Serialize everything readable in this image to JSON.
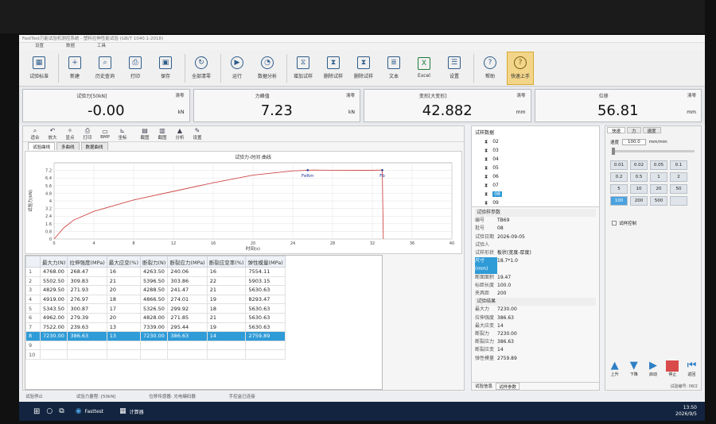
{
  "window": {
    "title": "FastTest万能试验机测控系统 - 塑料拉伸性能试验 (GB/T 1040.1-2018)"
  },
  "menu": [
    "设置",
    "数据",
    "工具"
  ],
  "toolbar": [
    {
      "icon": "grid-icon",
      "label": "试验标准"
    },
    {
      "icon": "new-icon",
      "label": "新建"
    },
    {
      "icon": "history-icon",
      "label": "历史查询"
    },
    {
      "icon": "print-icon",
      "label": "打印"
    },
    {
      "icon": "save-icon",
      "label": "保存"
    },
    {
      "icon": "refresh-icon",
      "label": "全部清零"
    },
    {
      "icon": "play-icon",
      "label": "运行"
    },
    {
      "icon": "analysis-icon",
      "label": "数据分析"
    },
    {
      "icon": "add-specimen-icon",
      "label": "增加试样"
    },
    {
      "icon": "delete-specimen-icon",
      "label": "删除试样"
    },
    {
      "icon": "delete-specimen-icon-2",
      "label": "删除试样"
    },
    {
      "icon": "text-icon",
      "label": "文本"
    },
    {
      "icon": "excel-icon",
      "label": "Excel"
    },
    {
      "icon": "settings-icon",
      "label": "设置"
    },
    {
      "icon": "help-icon",
      "label": "帮助"
    },
    {
      "icon": "help-icon-2",
      "label": "快速上手"
    }
  ],
  "readouts": [
    {
      "label": "试验力[50kN]",
      "value": "-0.00",
      "unit": "kN",
      "clear": "清零"
    },
    {
      "label": "力峰值",
      "value": "7.23",
      "unit": "kN",
      "clear": "清零"
    },
    {
      "label": "变形[大变形]",
      "value": "42.882",
      "unit": "mm",
      "clear": "清零"
    },
    {
      "label": "位移",
      "value": "56.81",
      "unit": "mm",
      "clear": "清零"
    }
  ],
  "graph_tools": [
    "适合",
    "放大",
    "显点",
    "打印",
    "BMP",
    "坐标",
    "截图",
    "截图",
    "分析",
    "设置"
  ],
  "curve_tabs": [
    "试验曲线",
    "多曲线",
    "数据曲线"
  ],
  "chart_data": {
    "type": "line",
    "title": "试验力-时间 曲线",
    "xlabel": "时间(s)",
    "ylabel": "试验力(kN)",
    "xlim": [
      0,
      40
    ],
    "ylim": [
      0,
      8
    ],
    "xticks": [
      "0",
      "4",
      "8",
      "12",
      "16",
      "20",
      "24",
      "28",
      "32",
      "36",
      "40"
    ],
    "yticks": [
      "0",
      "0.8",
      "1.6",
      "2.4",
      "3.2",
      "4",
      "4.8",
      "5.6",
      "6.4",
      "7.2"
    ],
    "x": [
      0,
      1,
      2,
      4,
      8,
      12,
      16,
      20,
      24,
      26,
      28,
      32,
      33,
      33.1
    ],
    "y": [
      0,
      1.2,
      2.0,
      2.9,
      4.1,
      5.0,
      5.9,
      6.7,
      7.15,
      7.23,
      7.22,
      7.21,
      7.23,
      0
    ],
    "annotations": [
      {
        "label": "FeRm",
        "x": 25.5,
        "y": 7.23
      },
      {
        "label": "Fb",
        "x": 33,
        "y": 7.23
      }
    ],
    "grid": true
  },
  "table": {
    "headers": [
      "",
      "最大力(N)",
      "拉伸强度(MPa)",
      "最大应变(%)",
      "断裂力(N)",
      "断裂应力(MPa)",
      "断裂应变率(%)",
      "弹性模量(MPa)"
    ],
    "rows": [
      [
        "1",
        "4768.00",
        "268.47",
        "16",
        "4263.50",
        "240.06",
        "16",
        "7554.11"
      ],
      [
        "2",
        "5502.50",
        "309.83",
        "21",
        "5396.50",
        "303.86",
        "22",
        "5903.15"
      ],
      [
        "3",
        "4829.50",
        "271.93",
        "20",
        "4288.50",
        "241.47",
        "21",
        "5630.63"
      ],
      [
        "4",
        "4919.00",
        "276.97",
        "18",
        "4866.50",
        "274.01",
        "19",
        "8293.47"
      ],
      [
        "5",
        "5343.50",
        "300.87",
        "17",
        "5326.50",
        "299.92",
        "18",
        "5630.63"
      ],
      [
        "6",
        "4962.00",
        "279.39",
        "20",
        "4828.00",
        "271.85",
        "21",
        "5630.63"
      ],
      [
        "7",
        "7522.00",
        "239.63",
        "13",
        "7339.00",
        "295.44",
        "19",
        "5630.63"
      ],
      [
        "8",
        "7230.00",
        "386.63",
        "13",
        "7230.00",
        "386.63",
        "14",
        "2759.89"
      ],
      [
        "9",
        "",
        "",
        "",
        "",
        "",
        "",
        ""
      ],
      [
        "10",
        "",
        "",
        "",
        "",
        "",
        "",
        ""
      ]
    ],
    "selected_row": 7
  },
  "tree": {
    "header": "试样数据",
    "items": [
      "02",
      "03",
      "04",
      "05",
      "06",
      "07",
      "08",
      "09"
    ],
    "selected": "08"
  },
  "params": {
    "header": "试验样参数",
    "rows": [
      {
        "k": "编号",
        "v": "TB69"
      },
      {
        "k": "批号",
        "v": "08"
      },
      {
        "k": "试验日期",
        "v": "2026-09-05"
      },
      {
        "k": "试验人",
        "v": ""
      },
      {
        "k": "试样形状",
        "v": "板状(宽度-厚度)"
      },
      {
        "k": "尺寸(mm)",
        "v": "18.7*1.0"
      },
      {
        "k": "断面面积",
        "v": "19.47"
      },
      {
        "k": "标距长度",
        "v": "100.0"
      },
      {
        "k": "夹具距",
        "v": "200"
      }
    ],
    "result_header": "试验结果",
    "results": [
      {
        "k": "最大力",
        "v": "7230.00"
      },
      {
        "k": "拉伸强度",
        "v": "386.63"
      },
      {
        "k": "最大应变",
        "v": "14"
      },
      {
        "k": "断裂力",
        "v": "7230.00"
      },
      {
        "k": "断裂应力",
        "v": "386.63"
      },
      {
        "k": "断裂应变",
        "v": "14"
      },
      {
        "k": "弹性模量",
        "v": "2759.89"
      }
    ],
    "tabs": [
      "试验信息",
      "试样参数"
    ]
  },
  "control": {
    "tabs": [
      "快速",
      "力",
      "速度"
    ],
    "speed_label": "速度",
    "speed_value": "100.0",
    "speed_unit": "mm/min",
    "keys": [
      "0.01",
      "0.02",
      "0.05",
      "0.1",
      "0.2",
      "0.5",
      "1",
      "2",
      "5",
      "10",
      "20",
      "50",
      "100",
      "200",
      "500",
      ""
    ],
    "selected_key": "100",
    "option": "试样控制",
    "buttons": [
      "上升",
      "下降",
      "启动",
      "停止",
      "返回"
    ],
    "counter": "试验编号: 08/2"
  },
  "statusbar": [
    "试验停止",
    "试验力量程: [50kN]",
    "位移传感器: 光电编码器",
    "手控盒已连接"
  ],
  "taskbar": {
    "apps": [
      "Fasttest",
      "计算器"
    ],
    "time": "13:50",
    "date": "2026/9/5"
  }
}
